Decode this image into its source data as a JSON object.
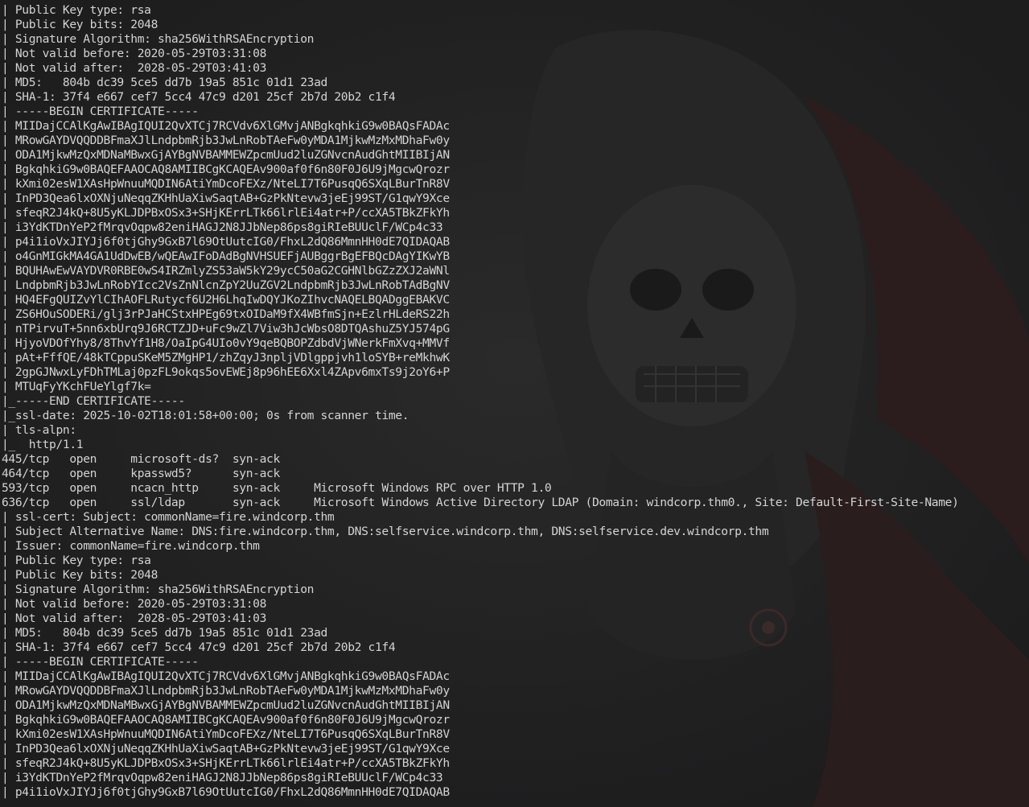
{
  "terminal": {
    "lines": [
      "| Public Key type: rsa",
      "| Public Key bits: 2048",
      "| Signature Algorithm: sha256WithRSAEncryption",
      "| Not valid before: 2020-05-29T03:31:08",
      "| Not valid after:  2028-05-29T03:41:03",
      "| MD5:   804b dc39 5ce5 dd7b 19a5 851c 01d1 23ad",
      "| SHA-1: 37f4 e667 cef7 5cc4 47c9 d201 25cf 2b7d 20b2 c1f4",
      "| -----BEGIN CERTIFICATE-----",
      "| MIIDajCCAlKgAwIBAgIQUI2QvXTCj7RCVdv6XlGMvjANBgkqhkiG9w0BAQsFADAc",
      "| MRowGAYDVQQDDBFmaXJlLndpbmRjb3JwLnRobTAeFw0yMDA1MjkwMzMxMDhaFw0y",
      "| ODA1MjkwMzQxMDNaMBwxGjAYBgNVBAMMEWZpcmUud2luZGNvcnAudGhtMIIBIjAN",
      "| BgkqhkiG9w0BAQEFAAOCAQ8AMIIBCgKCAQEAv900af0f6n80F0J6U9jMgcwQrozr",
      "| kXmi02esW1XAsHpWnuuMQDIN6AtiYmDcoFEXz/NteLI7T6PusqQ6SXqLBurTnR8V",
      "| InPD3Qea6lxOXNjuNeqqZKHhUaXiwSaqtAB+GzPkNtevw3jeEj99ST/G1qwY9Xce",
      "| sfeqR2J4kQ+8U5yKLJDPBxOSx3+SHjKErrLTk66lrlEi4atr+P/ccXA5TBkZFkYh",
      "| i3YdKTDnYeP2fMrqvOqpw82eniHAGJ2N8JJbNep86ps8giRIeBUUclF/WCp4c33",
      "| p4i1ioVxJIYJj6f0tjGhy9GxB7l69OtUutcIG0/FhxL2dQ86MmnHH0dE7QIDAQAB",
      "| o4GnMIGkMA4GA1UdDwEB/wQEAwIFoDAdBgNVHSUEFjAUBggrBgEFBQcDAgYIKwYB",
      "| BQUHAwEwVAYDVR0RBE0wS4IRZmlyZS53aW5kY29ycC50aG2CGHNlbGZzZXJ2aWNl",
      "| LndpbmRjb3JwLnRobYIcc2VsZnNlcnZpY2UuZGV2LndpbmRjb3JwLnRobTAdBgNV",
      "| HQ4EFgQUIZvYlCIhAOFLRutycf6U2H6LhqIwDQYJKoZIhvcNAQELBQADggEBAKVC",
      "| ZS6HOuSODERi/glj3rPJaHCStxHPEg69txOIDaM9fX4WBfmSjn+EzlrHLdeRS22h",
      "| nTPirvuT+5nn6xbUrq9J6RCTZJD+uFc9wZl7Viw3hJcWbsO8DTQAshuZ5YJ574pG",
      "| HjyoVDOfYhy8/8ThvYf1H8/OaIpG4UIo0vY9qeBQBOPZdbdVjWNerkFmXvq+MMVf",
      "| pAt+FffQE/48kTCppuSKeM5ZMgHP1/zhZqyJ3npljVDlgppjvh1loSYB+reMkhwK",
      "| 2gpGJNwxLyFDhTMLaj0pzFL9okqs5ovEWEj8p96hEE6Xxl4ZApv6mxTs9j2oY6+P",
      "| MTUqFyYKchFUeYlgf7k=",
      "|_-----END CERTIFICATE-----",
      "|_ssl-date: 2025-10-02T18:01:58+00:00; 0s from scanner time.",
      "| tls-alpn:",
      "|_  http/1.1",
      "445/tcp   open     microsoft-ds?  syn-ack",
      "464/tcp   open     kpasswd5?      syn-ack",
      "593/tcp   open     ncacn_http     syn-ack     Microsoft Windows RPC over HTTP 1.0",
      "636/tcp   open     ssl/ldap       syn-ack     Microsoft Windows Active Directory LDAP (Domain: windcorp.thm0., Site: Default-First-Site-Name)",
      "| ssl-cert: Subject: commonName=fire.windcorp.thm",
      "| Subject Alternative Name: DNS:fire.windcorp.thm, DNS:selfservice.windcorp.thm, DNS:selfservice.dev.windcorp.thm",
      "| Issuer: commonName=fire.windcorp.thm",
      "| Public Key type: rsa",
      "| Public Key bits: 2048",
      "| Signature Algorithm: sha256WithRSAEncryption",
      "| Not valid before: 2020-05-29T03:31:08",
      "| Not valid after:  2028-05-29T03:41:03",
      "| MD5:   804b dc39 5ce5 dd7b 19a5 851c 01d1 23ad",
      "| SHA-1: 37f4 e667 cef7 5cc4 47c9 d201 25cf 2b7d 20b2 c1f4",
      "| -----BEGIN CERTIFICATE-----",
      "| MIIDajCCAlKgAwIBAgIQUI2QvXTCj7RCVdv6XlGMvjANBgkqhkiG9w0BAQsFADAc",
      "| MRowGAYDVQQDDBFmaXJlLndpbmRjb3JwLnRobTAeFw0yMDA1MjkwMzMxMDhaFw0y",
      "| ODA1MjkwMzQxMDNaMBwxGjAYBgNVBAMMEWZpcmUud2luZGNvcnAudGhtMIIBIjAN",
      "| BgkqhkiG9w0BAQEFAAOCAQ8AMIIBCgKCAQEAv900af0f6n80F0J6U9jMgcwQrozr",
      "| kXmi02esW1XAsHpWnuuMQDIN6AtiYmDcoFEXz/NteLI7T6PusqQ6SXqLBurTnR8V",
      "| InPD3Qea6lxOXNjuNeqqZKHhUaXiwSaqtAB+GzPkNtevw3jeEj99ST/G1qwY9Xce",
      "| sfeqR2J4kQ+8U5yKLJDPBxOSx3+SHjKErrLTk66lrlEi4atr+P/ccXA5TBkZFkYh",
      "| i3YdKTDnYeP2fMrqvOqpw82eniHAGJ2N8JJbNep86ps8giRIeBUUclF/WCp4c33",
      "| p4i1ioVxJIYJj6f0tjGhy9GxB7l69OtUutcIG0/FhxL2dQ86MmnHH0dE7QIDAQAB"
    ]
  }
}
